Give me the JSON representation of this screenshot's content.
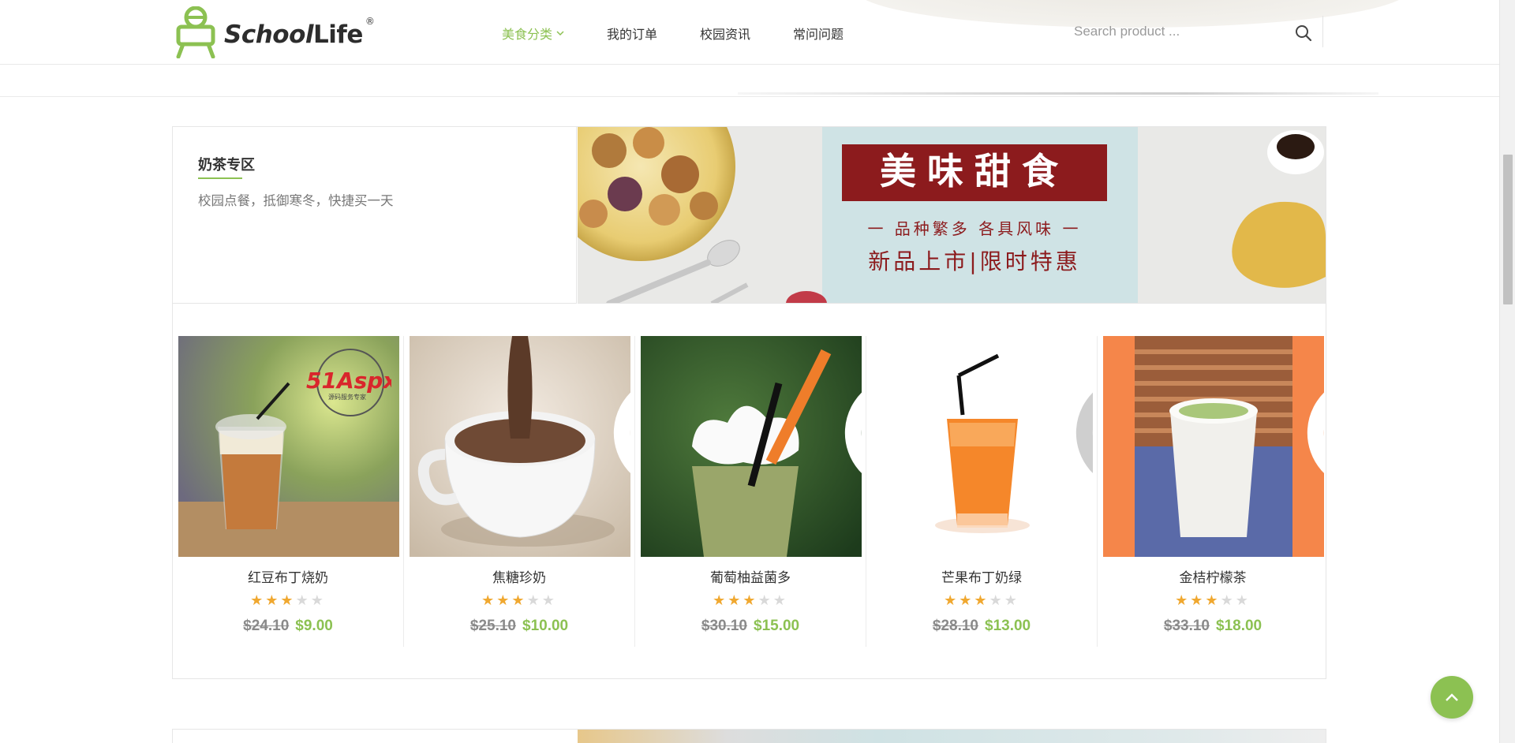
{
  "brand": {
    "name_part1": "School",
    "name_part2": "Life",
    "registered": "®",
    "accent": "#8cc152"
  },
  "nav": {
    "items": [
      {
        "label": "美食分类",
        "active": true,
        "has_dropdown": true
      },
      {
        "label": "我的订单",
        "active": false
      },
      {
        "label": "校园资讯",
        "active": false
      },
      {
        "label": "常问问题",
        "active": false
      }
    ]
  },
  "search": {
    "placeholder": "Search product ...",
    "value": "",
    "icon": "search-icon"
  },
  "section": {
    "title": "奶茶专区",
    "subtitle": "校园点餐，抵御寒冬，快捷买一天",
    "banner": {
      "headline": "美味甜食",
      "tagline": "一  品种繁多  各具风味  一",
      "promo": "新品上市|限时特惠"
    }
  },
  "watermark": {
    "brand": "51Aspx",
    "caption": "源码服务专家"
  },
  "products": [
    {
      "name": "红豆布丁烧奶",
      "rating": 3,
      "max_rating": 5,
      "old_price": "$24.10",
      "price": "$9.00",
      "favorited": false
    },
    {
      "name": "焦糖珍奶",
      "rating": 3,
      "max_rating": 5,
      "old_price": "$25.10",
      "price": "$10.00",
      "favorited": false
    },
    {
      "name": "葡萄柚益菌多",
      "rating": 3,
      "max_rating": 5,
      "old_price": "$30.10",
      "price": "$15.00",
      "favorited": false
    },
    {
      "name": "芒果布丁奶绿",
      "rating": 3,
      "max_rating": 5,
      "old_price": "$28.10",
      "price": "$13.00",
      "favorited": false
    },
    {
      "name": "金桔柠檬茶",
      "rating": 3,
      "max_rating": 5,
      "old_price": "$33.10",
      "price": "$18.00",
      "favorited": false
    }
  ],
  "ui": {
    "back_to_top_icon": "chevron-up-icon",
    "favorite_icon": "heart-icon"
  }
}
